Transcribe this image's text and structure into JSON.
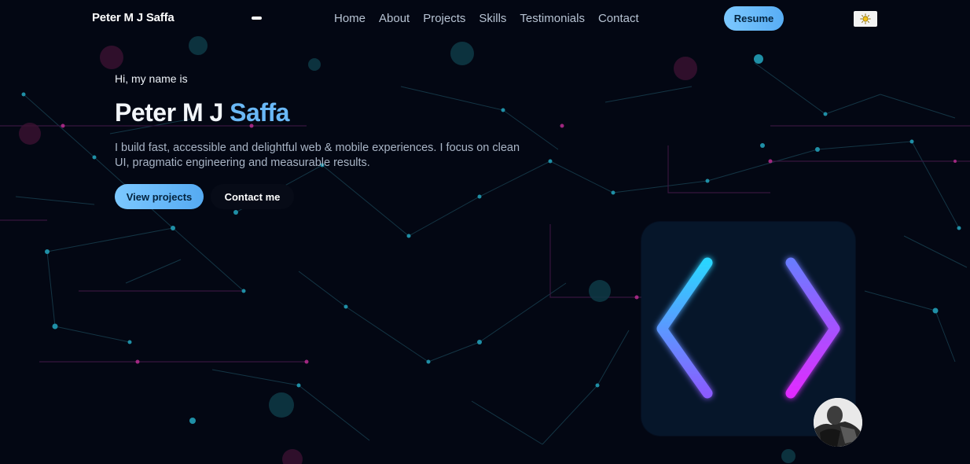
{
  "nav": {
    "brand": "Peter M J Saffa",
    "links": [
      "Home",
      "About",
      "Projects",
      "Skills",
      "Testimonials",
      "Contact"
    ],
    "resume_label": "Resume",
    "theme_icon": "sun-icon"
  },
  "hero": {
    "greeting": "Hi, my name is",
    "name_first": "Peter M J",
    "name_last": "Saffa",
    "description": "I build fast, accessible and delightful web & mobile experiences. I focus on clean UI, pragmatic engineering and measurable results.",
    "primary_cta": "View projects",
    "secondary_cta": "Contact me"
  },
  "illustration": {
    "icon": "code-brackets-icon",
    "left_gradient": [
      "#2bd5ff",
      "#8a5cff"
    ],
    "right_gradient": [
      "#6b7bff",
      "#e02bff"
    ]
  },
  "colors": {
    "background": "#030713",
    "accent": "#6ab8f6",
    "card": "#06162a"
  }
}
